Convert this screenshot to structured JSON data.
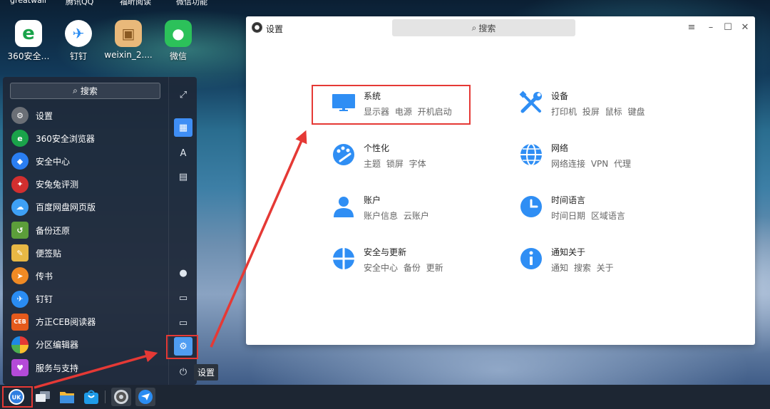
{
  "desktop": {
    "top_strip_labels": [
      "greatwall",
      "腾讯QQ",
      "福昕阅读",
      "微信功能"
    ],
    "icons": [
      {
        "name": "360安全…",
        "color": "#1aa34a",
        "glyph": "e"
      },
      {
        "name": "钉钉",
        "color": "#2a8cf2",
        "glyph": "✈"
      },
      {
        "name": "weixin_2....",
        "color": "#f0b060",
        "glyph": "▣"
      },
      {
        "name": "微信",
        "color": "#2cc15a",
        "glyph": "●"
      }
    ]
  },
  "start_menu": {
    "search_placeholder": "搜索",
    "apps": [
      {
        "label": "设置",
        "icon": "gear-icon",
        "color": "#6b6f76"
      },
      {
        "label": "360安全浏览器",
        "icon": "browser-360-icon",
        "color": "#1aa34a"
      },
      {
        "label": "安全中心",
        "icon": "shield-icon",
        "color": "#2a7ef2"
      },
      {
        "label": "安兔兔评测",
        "icon": "antutu-icon",
        "color": "#d22f2f"
      },
      {
        "label": "百度网盘网页版",
        "icon": "cloud-disk-icon",
        "color": "#3ea0f5"
      },
      {
        "label": "备份还原",
        "icon": "backup-icon",
        "color": "#5c9e3a"
      },
      {
        "label": "便签贴",
        "icon": "note-icon",
        "color": "#e8b845"
      },
      {
        "label": "传书",
        "icon": "send-icon",
        "color": "#f08a24"
      },
      {
        "label": "钉钉",
        "icon": "dingtalk-icon",
        "color": "#2a8cf2"
      },
      {
        "label": "方正CEB阅读器",
        "icon": "ceb-reader-icon",
        "color": "#e55a1c"
      },
      {
        "label": "分区编辑器",
        "icon": "partition-icon",
        "color": "#4caf50"
      },
      {
        "label": "服务与支持",
        "icon": "support-icon",
        "color": "#b44ad8"
      }
    ],
    "tooltip": "设置"
  },
  "settings": {
    "title": "设置",
    "search_placeholder": "搜索",
    "categories": [
      {
        "title": "系统",
        "sub": "显示器 电源 开机启动",
        "icon": "monitor-icon"
      },
      {
        "title": "设备",
        "sub": "打印机 投屏 鼠标 键盘",
        "icon": "tools-icon"
      },
      {
        "title": "个性化",
        "sub": "主题 锁屏 字体",
        "icon": "palette-icon"
      },
      {
        "title": "网络",
        "sub": "网络连接 VPN 代理",
        "icon": "globe-icon"
      },
      {
        "title": "账户",
        "sub": "账户信息 云账户",
        "icon": "user-icon"
      },
      {
        "title": "时间语言",
        "sub": "时间日期 区域语言",
        "icon": "clock-icon"
      },
      {
        "title": "安全与更新",
        "sub": "安全中心 备份 更新",
        "icon": "security-icon"
      },
      {
        "title": "通知关于",
        "sub": "通知 搜索 关于",
        "icon": "info-icon"
      }
    ]
  },
  "colors": {
    "accent": "#2f8ef4",
    "highlight": "#e53935"
  }
}
